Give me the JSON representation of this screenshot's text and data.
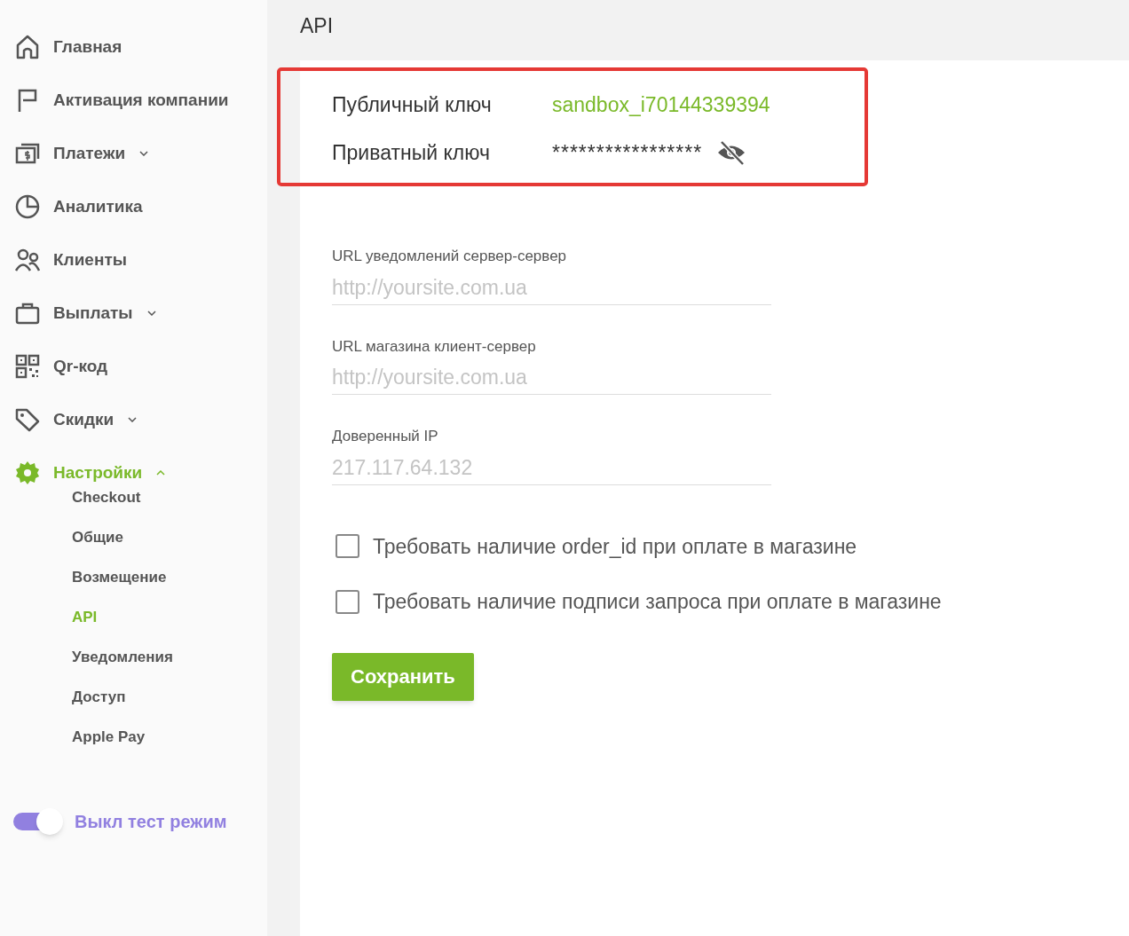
{
  "sidebar": {
    "items": [
      {
        "label": "Главная",
        "selected": false
      },
      {
        "label": "Активация компании",
        "selected": false
      },
      {
        "label": "Платежи",
        "selected": false,
        "expanded": false
      },
      {
        "label": "Аналитика",
        "selected": false
      },
      {
        "label": "Клиенты",
        "selected": false
      },
      {
        "label": "Выплаты",
        "selected": false,
        "expanded": false
      },
      {
        "label": "Qr-код",
        "selected": false
      },
      {
        "label": "Скидки",
        "selected": false,
        "expanded": false
      },
      {
        "label": "Настройки",
        "selected": true,
        "expanded": true,
        "children": [
          {
            "label": "Checkout",
            "selected": false
          },
          {
            "label": "Общие",
            "selected": false
          },
          {
            "label": "Возмещение",
            "selected": false
          },
          {
            "label": "API",
            "selected": true
          },
          {
            "label": "Уведомления",
            "selected": false
          },
          {
            "label": "Доступ",
            "selected": false
          },
          {
            "label": "Apple Pay",
            "selected": false
          }
        ]
      }
    ]
  },
  "test_mode": {
    "label": "Выкл тест режим",
    "on": true
  },
  "header": {
    "title": "API"
  },
  "keys": [
    {
      "label": "Публичный ключ",
      "value": "sandbox_i70144339394",
      "kind": "public"
    },
    {
      "label": "Приватный ключ",
      "value": "*****************",
      "kind": "secret"
    }
  ],
  "fields": [
    {
      "label": "URL уведомлений сервер-сервер",
      "placeholder": "http://yoursite.com.ua"
    },
    {
      "label": "URL магазина клиент-сервер",
      "placeholder": "http://yoursite.com.ua"
    },
    {
      "label": "Доверенный IP",
      "placeholder": "217.117.64.132"
    }
  ],
  "checkboxes": [
    {
      "label": "Требовать наличие order_id при оплате в магазине",
      "checked": false
    },
    {
      "label": "Требовать наличие подписи запроса при оплате в магазине",
      "checked": false
    }
  ],
  "save_button": "Сохранить"
}
